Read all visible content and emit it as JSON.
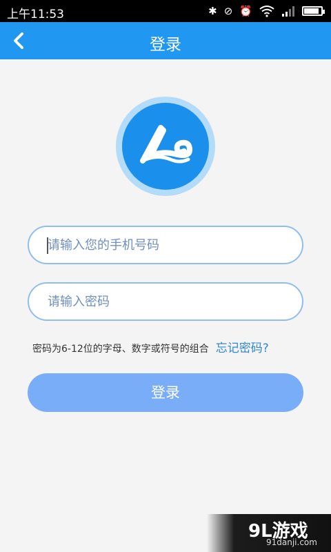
{
  "status_bar": {
    "time": "上午11:53",
    "icons": [
      "bluetooth-icon",
      "vibrate-off-icon",
      "alarm-icon",
      "wifi-icon",
      "signal-icon",
      "battery-icon"
    ],
    "battery_level": 0.8
  },
  "header": {
    "title": "登录",
    "back_icon": "chevron-left-icon",
    "background_color": "#2097f0"
  },
  "logo": {
    "icon": "app-logo-icon",
    "color": "#1a8fec"
  },
  "form": {
    "phone_placeholder": "请输入您的手机号码",
    "phone_value": "",
    "password_placeholder": "请输入密码",
    "password_value": "",
    "hint": "密码为6-12位的字母、数字或符号的组合",
    "forgot_link": "忘记密码?",
    "submit_label": "登录",
    "submit_color": "#7aadf7"
  },
  "watermark": {
    "brand": "9L游戏",
    "domain": "91danji.com"
  }
}
